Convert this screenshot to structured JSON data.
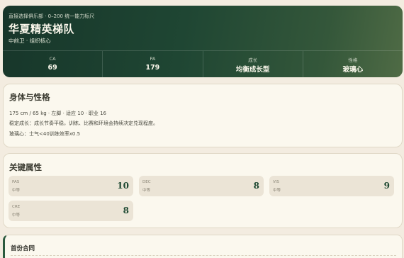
{
  "hero": {
    "subtitle": "直接选择俱乐部 · 0–200 统一能力标尺",
    "title": "华夏精英梯队",
    "role": "中前卫 · 组织核心",
    "stats": [
      {
        "label": "CA",
        "value": "69"
      },
      {
        "label": "PA",
        "value": "179"
      },
      {
        "label": "成长",
        "value": "均衡成长型"
      },
      {
        "label": "性格",
        "value": "玻璃心"
      }
    ]
  },
  "profile": {
    "title": "身体与性格",
    "lines": [
      "175 cm / 65 kg · 左脚 · 适应 10 · 职业 16",
      "稳定成长：成长节奏平稳，训练、比赛和环境会持续决定兑现程度。",
      "玻璃心：士气<40训练效率x0.5"
    ]
  },
  "attributes": {
    "title": "关键属性",
    "items": [
      {
        "code": "PAS",
        "grade": "中等",
        "value": "10"
      },
      {
        "code": "DEC",
        "grade": "中等",
        "value": "8"
      },
      {
        "code": "VIS",
        "grade": "中等",
        "value": "9"
      },
      {
        "code": "CRE",
        "grade": "中等",
        "value": "8"
      }
    ]
  },
  "contract": {
    "title": "首份合同"
  },
  "colors": {
    "accent": "#1f4a33",
    "background": "#f3ece0",
    "card": "#fbf8ee"
  }
}
